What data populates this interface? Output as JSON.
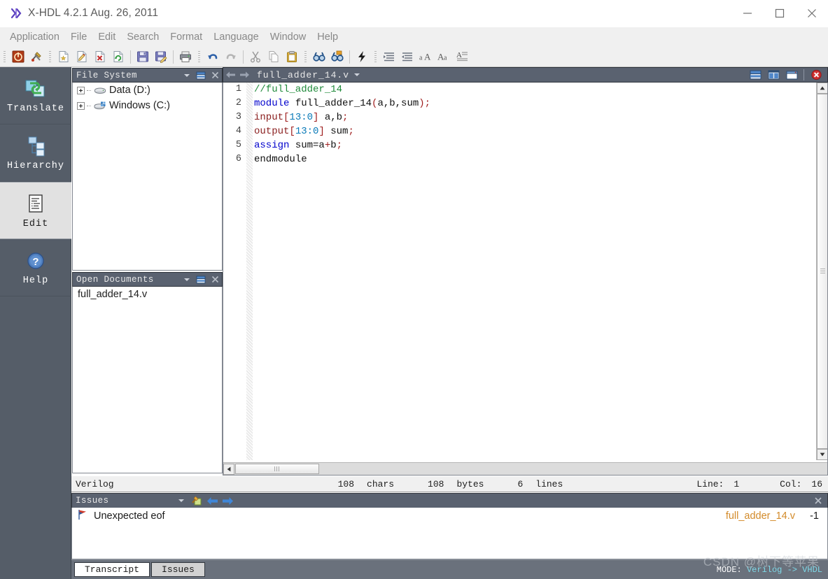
{
  "window": {
    "icon": "x-hdl-logo-icon",
    "title": "X-HDL 4.2.1  Aug. 26, 2011",
    "minimize_label": "—",
    "maximize_label": "□",
    "close_label": "✕"
  },
  "menubar": {
    "items": [
      {
        "label": "Application",
        "name": "menu-application"
      },
      {
        "label": "File",
        "name": "menu-file"
      },
      {
        "label": "Edit",
        "name": "menu-edit"
      },
      {
        "label": "Search",
        "name": "menu-search"
      },
      {
        "label": "Format",
        "name": "menu-format"
      },
      {
        "label": "Language",
        "name": "menu-language"
      },
      {
        "label": "Window",
        "name": "menu-window"
      },
      {
        "label": "Help",
        "name": "menu-help"
      }
    ]
  },
  "toolbar": {
    "buttons": [
      {
        "icon": "power-exit-icon",
        "title": "Exit"
      },
      {
        "icon": "tools-options-icon",
        "title": "Options"
      },
      {
        "icon": "new-file-icon",
        "title": "New"
      },
      {
        "icon": "edit-file-icon",
        "title": "Open for edit"
      },
      {
        "icon": "close-file-icon",
        "title": "Close file"
      },
      {
        "icon": "reload-file-icon",
        "title": "Reload file"
      },
      {
        "icon": "save-icon",
        "title": "Save"
      },
      {
        "icon": "save-as-icon",
        "title": "Save As"
      },
      {
        "icon": "print-icon",
        "title": "Print"
      },
      {
        "icon": "undo-icon",
        "title": "Undo"
      },
      {
        "icon": "redo-icon",
        "title": "Redo"
      },
      {
        "icon": "cut-icon",
        "title": "Cut"
      },
      {
        "icon": "copy-icon",
        "title": "Copy"
      },
      {
        "icon": "paste-icon",
        "title": "Paste"
      },
      {
        "icon": "find-icon",
        "title": "Find"
      },
      {
        "icon": "find-replace-icon",
        "title": "Find and Replace"
      },
      {
        "icon": "translate-run-icon",
        "title": "Translate"
      },
      {
        "icon": "indent-right-icon",
        "title": "Indent"
      },
      {
        "icon": "indent-left-icon",
        "title": "Unindent"
      },
      {
        "icon": "lowercase-icon",
        "title": "Lower case"
      },
      {
        "icon": "uppercase-icon",
        "title": "Upper case"
      },
      {
        "icon": "format-text-icon",
        "title": "Format"
      }
    ]
  },
  "rail": {
    "items": [
      {
        "label": "Translate",
        "icon": "translate-arrows-icon",
        "name": "rail-item-translate",
        "selected": false
      },
      {
        "label": "Hierarchy",
        "icon": "hierarchy-tree-icon",
        "name": "rail-item-hierarchy",
        "selected": false
      },
      {
        "label": "Edit",
        "icon": "edit-document-icon",
        "name": "rail-item-edit",
        "selected": true
      },
      {
        "label": "Help",
        "icon": "help-question-icon",
        "name": "rail-item-help",
        "selected": false
      }
    ]
  },
  "file_system_panel": {
    "title": "File System",
    "menu_icon": "chevron-down-icon",
    "restore_icon": "restore-window-icon",
    "close_icon": "close-icon",
    "tree": [
      {
        "label": "Data (D:)",
        "icon": "hard-drive-icon",
        "expanded": false
      },
      {
        "label": "Windows (C:)",
        "icon": "system-drive-icon",
        "expanded": false
      }
    ]
  },
  "open_documents_panel": {
    "title": "Open Documents",
    "menu_icon": "chevron-down-icon",
    "restore_icon": "restore-window-icon",
    "close_icon": "close-icon",
    "documents": [
      {
        "label": "full_adder_14.v"
      }
    ]
  },
  "editor": {
    "back_icon": "arrow-left-icon",
    "forward_icon": "arrow-right-icon",
    "tab_title": "full_adder_14.v",
    "tab_caret_icon": "chevron-down-icon",
    "window_buttons": [
      {
        "icon": "split-horizontal-icon",
        "name": "split-horizontal-button"
      },
      {
        "icon": "split-vertical-icon",
        "name": "split-vertical-button"
      },
      {
        "icon": "restore-window-icon",
        "name": "restore-window-button"
      },
      {
        "icon": "close-red-icon",
        "name": "close-editor-button"
      }
    ],
    "line_numbers": [
      "1",
      "2",
      "3",
      "4",
      "5",
      "6"
    ],
    "code_lines": [
      [
        {
          "t": "//full_adder_14",
          "c": "cm"
        }
      ],
      [
        {
          "t": "module",
          "c": "k"
        },
        {
          "t": " full_adder_14",
          "c": "pl"
        },
        {
          "t": "(",
          "c": "op"
        },
        {
          "t": "a,b,sum",
          "c": "pl"
        },
        {
          "t": ")",
          "c": "op"
        },
        {
          "t": ";",
          "c": "op"
        }
      ],
      [
        {
          "t": "input",
          "c": "k2"
        },
        {
          "t": "[",
          "c": "op"
        },
        {
          "t": "13:0",
          "c": "num"
        },
        {
          "t": "]",
          "c": "op"
        },
        {
          "t": " a,b",
          "c": "pl"
        },
        {
          "t": ";",
          "c": "op"
        }
      ],
      [
        {
          "t": "output",
          "c": "k2"
        },
        {
          "t": "[",
          "c": "op"
        },
        {
          "t": "13:0",
          "c": "num"
        },
        {
          "t": "]",
          "c": "op"
        },
        {
          "t": " sum",
          "c": "pl"
        },
        {
          "t": ";",
          "c": "op"
        }
      ],
      [
        {
          "t": "assign",
          "c": "k"
        },
        {
          "t": " sum=a",
          "c": "pl"
        },
        {
          "t": "+",
          "c": "op"
        },
        {
          "t": "b",
          "c": "pl"
        },
        {
          "t": ";",
          "c": "op"
        }
      ],
      [
        {
          "t": "endmodule",
          "c": "pl"
        }
      ]
    ]
  },
  "statusbar": {
    "language": "Verilog",
    "chars_value": "108",
    "chars_label": "chars",
    "bytes_value": "108",
    "bytes_label": "bytes",
    "lines_value": "6",
    "lines_label": "lines",
    "line_label": "Line:",
    "line_value": "1",
    "col_label": "Col:",
    "col_value": "16"
  },
  "issues_panel": {
    "title": "Issues",
    "menu_icon": "chevron-down-icon",
    "clear_icon": "clear-issues-icon",
    "prev_icon": "arrow-left-icon",
    "next_icon": "arrow-right-icon",
    "close_icon": "close-icon",
    "rows": [
      {
        "severity_icon": "error-flag-icon",
        "message": "Unexpected eof",
        "file": "full_adder_14.v",
        "line": "-1"
      }
    ]
  },
  "bottom_tabs": {
    "tabs": [
      {
        "label": "Transcript",
        "name": "tab-transcript",
        "active": true
      },
      {
        "label": "Issues",
        "name": "tab-issues",
        "active": false
      }
    ],
    "mode_label": "MODE:",
    "mode_value": "Verilog -> VHDL"
  },
  "watermark": {
    "text": "CSDN @树下等苹果"
  },
  "colors": {
    "panel_header": "#5a6270",
    "rail_bg": "#555d68",
    "accent_blue": "#4a90d9",
    "error_orange": "#d38b2a",
    "keyword_blue": "#0000cc",
    "keyword_red": "#8b2020",
    "comment_green": "#1f8a3a",
    "mode_cyan": "#7fd9e8"
  }
}
